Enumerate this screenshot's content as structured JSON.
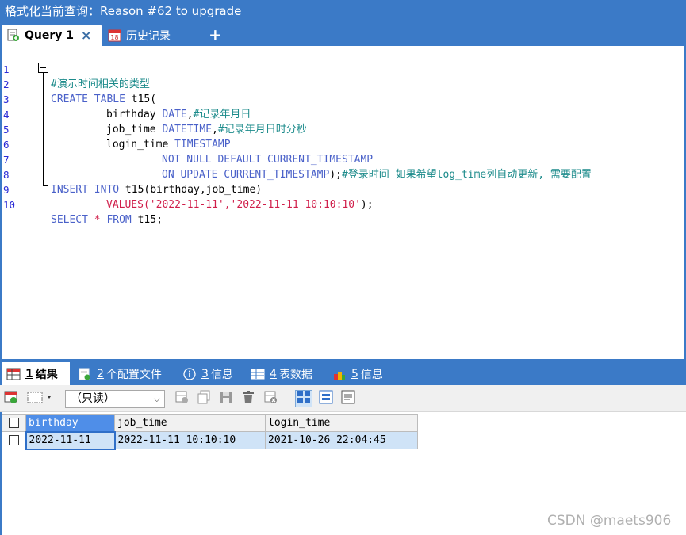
{
  "window": {
    "title": "格式化当前查询：Reason #62 to upgrade"
  },
  "tabs": [
    {
      "label": "Query 1",
      "icon": "query-file-icon",
      "active": true
    },
    {
      "label": "历史记录",
      "icon": "calendar-icon",
      "active": false
    }
  ],
  "tab_close": "×",
  "tab_add": "+",
  "editor": {
    "line_numbers": [
      "1",
      "2",
      "3",
      "4",
      "5",
      "6",
      "7",
      "8",
      "9",
      "10"
    ],
    "lines": {
      "l1": {
        "comment": "#演示时间相关的类型"
      },
      "l2": {
        "kw1": "CREATE TABLE",
        "rest": " t15("
      },
      "l3": {
        "ident": "birthday",
        "type": "DATE",
        "punct": ",",
        "comment": "#记录年月日"
      },
      "l4": {
        "ident": "job_time",
        "type": "DATETIME",
        "punct": ",",
        "comment": "#记录年月日时分秒"
      },
      "l5": {
        "ident": "login_time",
        "type": "TIMESTAMP"
      },
      "l6": {
        "kw": "NOT NULL DEFAULT CURRENT_TIMESTAMP"
      },
      "l7": {
        "kw": "ON UPDATE CURRENT_TIMESTAMP",
        "punct": ");",
        "comment": "#登录时间 如果希望log_time列自动更新, 需要配置"
      },
      "l8": {
        "kw": "INSERT INTO",
        "rest": " t15(birthday,job_time)"
      },
      "l9": {
        "kw": "VALUES",
        "p1": "(",
        "s1": "'2022-11-11'",
        "p2": ",",
        "s2": "'2022-11-11 10:10:10'",
        "p3": ");"
      },
      "l10": {
        "kw1": "SELECT",
        "op": " * ",
        "kw2": "FROM",
        "rest": " t15;"
      }
    }
  },
  "result_tabs": [
    {
      "num": "1",
      "label": "结果",
      "icon": "result-grid-icon",
      "active": true
    },
    {
      "num": "2",
      "label": "个配置文件",
      "icon": "profile-icon",
      "active": false
    },
    {
      "num": "3",
      "label": "信息",
      "icon": "info-icon",
      "active": false
    },
    {
      "num": "4",
      "label": "表数据",
      "icon": "table-data-icon",
      "active": false
    },
    {
      "num": "5",
      "label": "信息",
      "icon": "info-chart-icon",
      "active": false
    }
  ],
  "toolbar": {
    "mode_select": "（只读）",
    "icons": [
      "export-icon",
      "view-mode-icon",
      "add-row-icon",
      "copy-row-icon",
      "save-icon",
      "delete-icon",
      "refresh-icon",
      "grid-view-icon",
      "form-view-icon",
      "text-view-icon"
    ]
  },
  "grid": {
    "columns": [
      "birthday",
      "job_time",
      "login_time"
    ],
    "rows": [
      [
        "2022-11-11",
        "2022-11-11 10:10:10",
        "2021-10-26 22:04:45"
      ]
    ]
  },
  "watermark": "CSDN @maets906",
  "colors": {
    "accent": "#3b7ac7",
    "keyword": "#4a61c9",
    "string": "#d01e4a",
    "comment": "#1c8b8b",
    "selection": "#cfe3f7"
  }
}
